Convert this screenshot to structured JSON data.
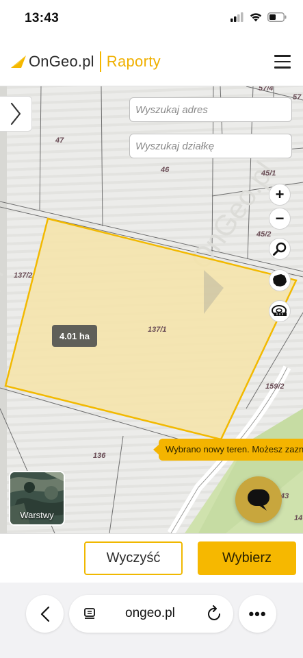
{
  "status": {
    "time": "13:43"
  },
  "header": {
    "brand": "OnGeo.pl",
    "section": "Raporty"
  },
  "map": {
    "address_placeholder": "Wyszukaj adres",
    "plot_placeholder": "Wyszukaj działkę",
    "parcels": [
      "57/4",
      "57",
      "47",
      "46",
      "45/1",
      "45/2",
      "137/2",
      "137/1",
      "159/2",
      "136",
      "43",
      "14"
    ],
    "selected_area": "4.01 ha",
    "zoom_in": "+",
    "zoom_out": "−",
    "toast": "Wybrano nowy teren. Możesz zazn",
    "layers_label": "Warstwy",
    "watermark": "OnGeo.pl"
  },
  "actions": {
    "clear_label": "Wyczyść",
    "select_label": "Wybierz"
  },
  "browser": {
    "url": "ongeo.pl",
    "more_label": "•••"
  },
  "colors": {
    "accent": "#f6b800",
    "parcel_fill": "#f6e4a8",
    "parcel_border": "#f2b900"
  }
}
